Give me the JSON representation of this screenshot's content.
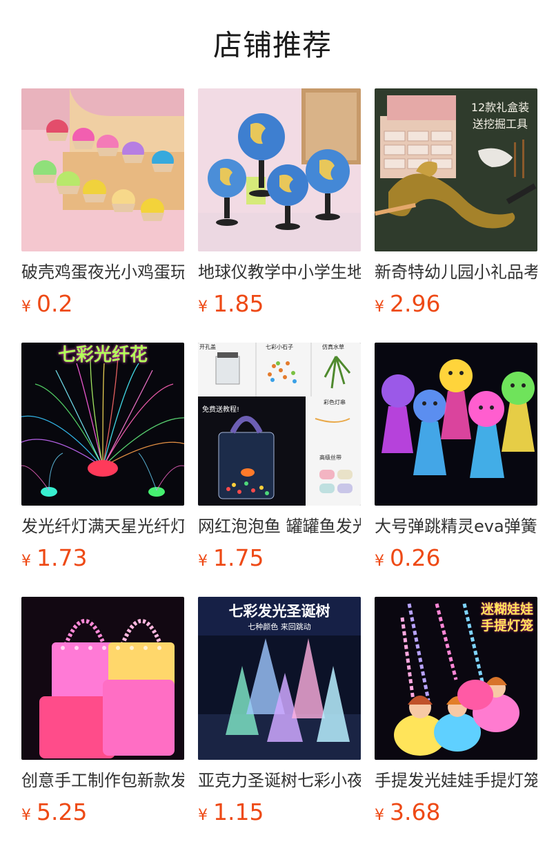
{
  "page": {
    "title": "店铺推荐"
  },
  "colors": {
    "price": "#ee4a16",
    "title": "#1a1a1a",
    "name": "#333333"
  },
  "products": [
    {
      "name": "破壳鸡蛋夜光小鸡蛋玩具",
      "currency": "¥",
      "price": "0.2",
      "image_icon": "glowing-chick-eggs-image"
    },
    {
      "name": "地球仪教学中小学生地理",
      "currency": "¥",
      "price": "1.85",
      "image_icon": "globe-image"
    },
    {
      "name": "新奇特幼儿园小礼品考古",
      "currency": "¥",
      "price": "2.96",
      "image_icon": "dig-kit-dragon-image",
      "image_text": {
        "banner": "12款礼盒装",
        "banner2": "送挖掘工具"
      }
    },
    {
      "name": "发光纤灯满天星光纤灯玩具",
      "currency": "¥",
      "price": "1.73",
      "image_icon": "fiber-optic-lamp-image",
      "image_text": {
        "banner": "七彩光纤花"
      }
    },
    {
      "name": "网红泡泡鱼 罐罐鱼发光",
      "currency": "¥",
      "price": "1.75",
      "image_icon": "bottle-fish-kit-image",
      "image_text": {
        "t1": "开孔盖",
        "t2": "七彩小石子",
        "t3": "仿真水草",
        "t4": "免费送教程!",
        "t5": "彩色灯串",
        "t6": "高级丝带"
      }
    },
    {
      "name": "大号弹跳精灵eva弹簧发光",
      "currency": "¥",
      "price": "0.26",
      "image_icon": "jumping-spring-doll-image"
    },
    {
      "name": "创意手工制作包新款发光",
      "currency": "¥",
      "price": "5.25",
      "image_icon": "glowing-handbag-image"
    },
    {
      "name": "亚克力圣诞树七彩小夜灯",
      "currency": "¥",
      "price": "1.15",
      "image_icon": "acrylic-xmas-tree-image",
      "image_text": {
        "banner": "七彩发光圣诞树",
        "sub": "七种颜色 来回跳动"
      }
    },
    {
      "name": "手提发光娃娃手提灯笼",
      "currency": "¥",
      "price": "3.68",
      "image_icon": "doll-lantern-image",
      "image_text": {
        "banner": "迷糊娃娃",
        "banner2": "手提灯笼"
      }
    }
  ]
}
